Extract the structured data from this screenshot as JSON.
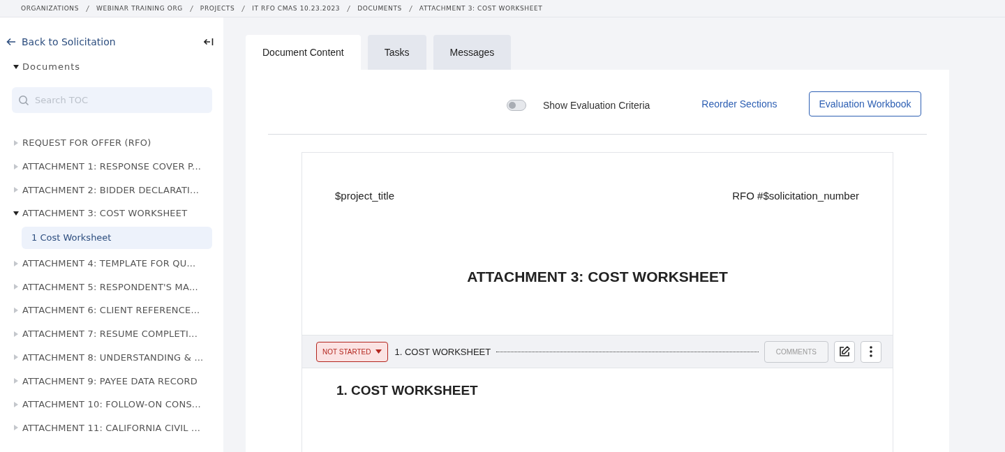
{
  "breadcrumbs": [
    "ORGANIZATIONS",
    "WEBINAR TRAINING ORG",
    "PROJECTS",
    "IT RFO CMAS 10.23.2023",
    "DOCUMENTS",
    "ATTACHMENT 3: COST WORKSHEET"
  ],
  "sidebar": {
    "back_link": "Back to Solicitation",
    "section": {
      "label": "Documents",
      "expanded": true
    },
    "search": {
      "placeholder": "Search TOC"
    },
    "items": [
      {
        "label": "REQUEST FOR OFFER (RFO)",
        "expanded": false
      },
      {
        "label": "ATTACHMENT 1: RESPONSE COVER P...",
        "expanded": false
      },
      {
        "label": "ATTACHMENT 2: BIDDER DECLARATI...",
        "expanded": false
      },
      {
        "label": "ATTACHMENT 3: COST WORKSHEET",
        "expanded": true,
        "children": [
          {
            "label": "1 Cost Worksheet",
            "selected": true
          }
        ]
      },
      {
        "label": "ATTACHMENT 4: TEMPLATE FOR QU...",
        "expanded": false
      },
      {
        "label": "ATTACHMENT 5: RESPONDENT'S MA...",
        "expanded": false
      },
      {
        "label": "ATTACHMENT 6: CLIENT REFERENCE...",
        "expanded": false
      },
      {
        "label": "ATTACHMENT 7: RESUME COMPLETI...",
        "expanded": false
      },
      {
        "label": "ATTACHMENT 8: UNDERSTANDING & ...",
        "expanded": false
      },
      {
        "label": "ATTACHMENT 9: PAYEE DATA RECORD",
        "expanded": false
      },
      {
        "label": "ATTACHMENT 10: FOLLOW-ON CONS...",
        "expanded": false
      },
      {
        "label": "ATTACHMENT 11: CALIFORNIA CIVIL ...",
        "expanded": false
      }
    ]
  },
  "tabs": [
    {
      "label": "Document Content",
      "selected": true
    },
    {
      "label": "Tasks",
      "selected": false
    },
    {
      "label": "Messages",
      "selected": false
    }
  ],
  "toolbar": {
    "toggle": {
      "label": "Show Evaluation Criteria",
      "on": false
    },
    "reorder_link": "Reorder Sections",
    "workbook_button": "Evaluation Workbook"
  },
  "document": {
    "header_left": "$project_title",
    "header_right": "RFO #$solicitation_number",
    "title": "ATTACHMENT 3: COST WORKSHEET",
    "section": {
      "status": "NOT STARTED",
      "title": "1. COST WORKSHEET",
      "comments_button": "COMMENTS",
      "heading": "1. COST WORKSHEET"
    }
  }
}
